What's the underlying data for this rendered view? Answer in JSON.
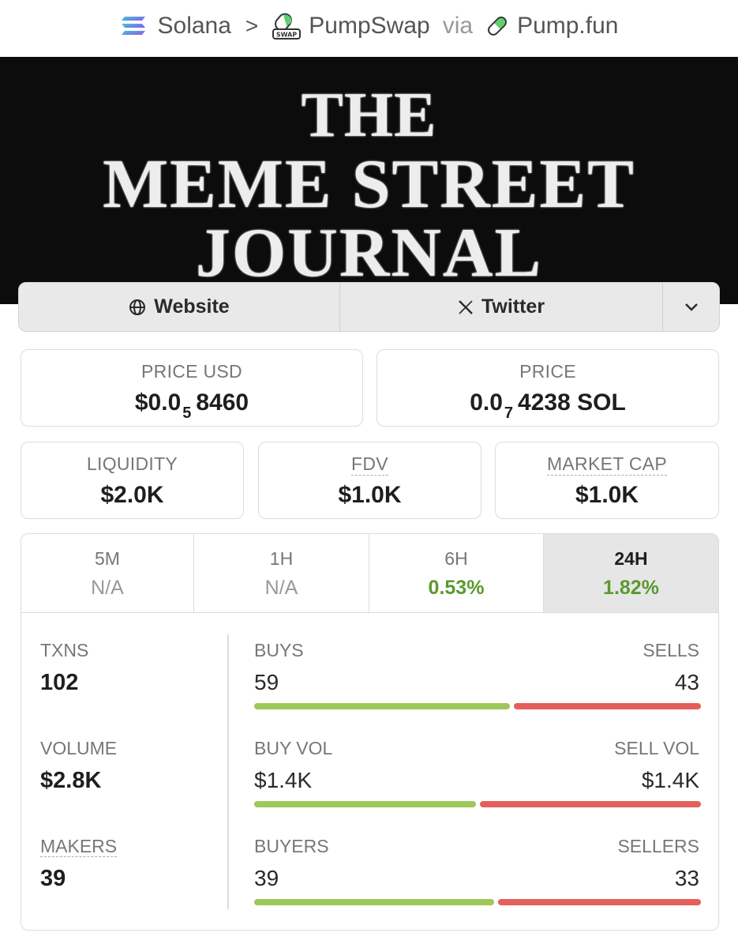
{
  "breadcrumb": {
    "chain": "Solana",
    "separator": ">",
    "dex": "PumpSwap",
    "dex_icon_text": "SWAP",
    "via": "via",
    "launchpad": "Pump.fun"
  },
  "banner": {
    "line1": "THE",
    "line2": "MEME STREET",
    "line3": "JOURNAL"
  },
  "links": {
    "website": "Website",
    "twitter": "Twitter"
  },
  "price_usd": {
    "label": "PRICE USD",
    "prefix": "$0.0",
    "zeros": "5",
    "digits": "8460"
  },
  "price_native": {
    "label": "PRICE",
    "prefix": "0.0",
    "zeros": "7",
    "digits": "4238 SOL"
  },
  "liquidity": {
    "label": "LIQUIDITY",
    "value": "$2.0K"
  },
  "fdv": {
    "label": "FDV",
    "value": "$1.0K"
  },
  "market_cap": {
    "label": "MARKET CAP",
    "value": "$1.0K"
  },
  "timeframes": [
    {
      "label": "5M",
      "value": "N/A"
    },
    {
      "label": "1H",
      "value": "N/A"
    },
    {
      "label": "6H",
      "value": "0.53%"
    },
    {
      "label": "24H",
      "value": "1.82%"
    }
  ],
  "active_timeframe": "24H",
  "metrics": {
    "txns": {
      "label": "TXNS",
      "value": "102"
    },
    "volume": {
      "label": "VOLUME",
      "value": "$2.8K"
    },
    "makers": {
      "label": "MAKERS",
      "value": "39"
    }
  },
  "splits": {
    "buys": {
      "label": "BUYS",
      "value": "59",
      "share": 0.578
    },
    "sells": {
      "label": "SELLS",
      "value": "43"
    },
    "buy_vol": {
      "label": "BUY VOL",
      "value": "$1.4K",
      "share": 0.5
    },
    "sell_vol": {
      "label": "SELL VOL",
      "value": "$1.4K"
    },
    "buyers": {
      "label": "BUYERS",
      "value": "39",
      "share": 0.542
    },
    "sellers": {
      "label": "SELLERS",
      "value": "33"
    }
  },
  "colors": {
    "positive": "#5a9a2e",
    "buy_bar": "#9ec85a",
    "sell_bar": "#e45f5b",
    "banner_bg": "#0c0c0c"
  }
}
